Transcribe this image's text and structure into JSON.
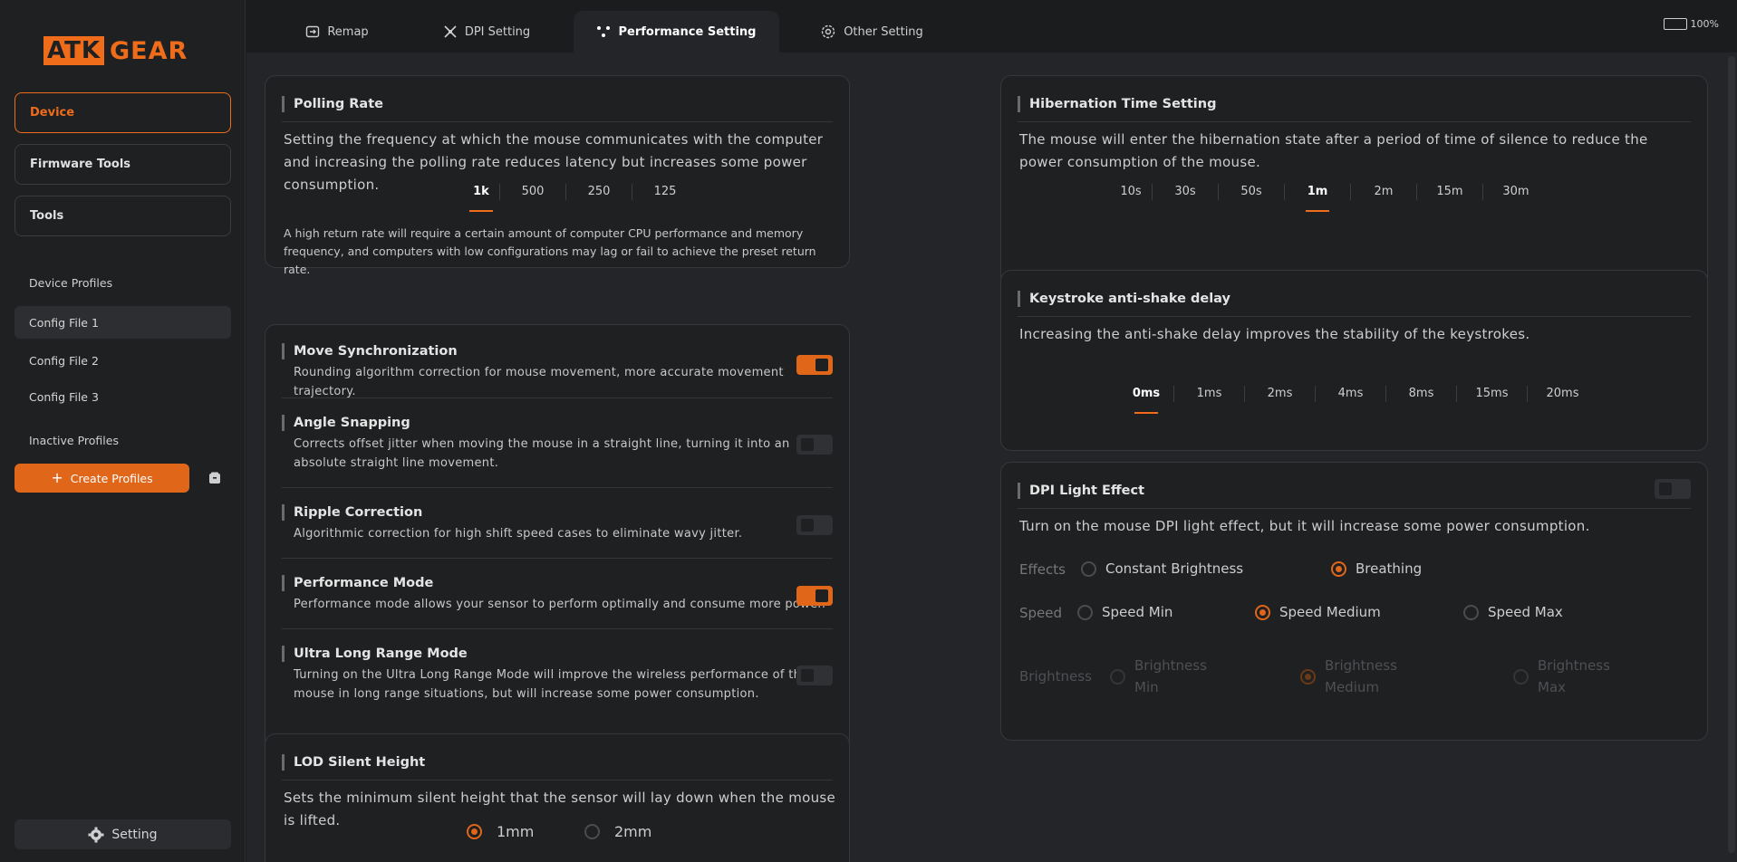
{
  "app": {
    "logo_box": "ATK",
    "logo_text": "GEAR",
    "battery": "100%"
  },
  "sidebar": {
    "nav": [
      {
        "label": "Device"
      },
      {
        "label": "Firmware Tools"
      },
      {
        "label": "Tools"
      }
    ],
    "device_profiles_label": "Device Profiles",
    "profiles": [
      "Config File 1",
      "Config File 2",
      "Config File 3"
    ],
    "inactive_label": "Inactive Profiles",
    "create_label": "Create Profiles",
    "setting_label": "Setting"
  },
  "tabs": [
    {
      "label": "Remap",
      "icon": "remap-icon"
    },
    {
      "label": "DPI Setting",
      "icon": "dpi-icon"
    },
    {
      "label": "Performance Setting",
      "icon": "performance-icon",
      "active": true
    },
    {
      "label": "Other Setting",
      "icon": "gear-icon"
    }
  ],
  "polling": {
    "title": "Polling Rate",
    "desc": "Setting the frequency at which the mouse communicates with the computer and increasing the polling rate reduces latency but increases some power consumption.",
    "options": [
      "1k",
      "500",
      "250",
      "125"
    ],
    "selected": "1k",
    "note": "A high return rate will require a certain amount of computer CPU performance and memory frequency, and computers with low configurations may lag or fail to achieve the preset return rate."
  },
  "features": [
    {
      "title": "Move Synchronization",
      "desc": "Rounding algorithm correction for mouse movement, more accurate movement trajectory.",
      "on": true
    },
    {
      "title": "Angle Snapping",
      "desc": "Corrects offset jitter when moving the mouse in a straight line, turning it into an absolute straight line movement.",
      "on": false
    },
    {
      "title": "Ripple Correction",
      "desc": "Algorithmic correction for high shift speed cases to eliminate wavy jitter.",
      "on": false
    },
    {
      "title": "Performance Mode",
      "desc": "Performance mode allows your sensor to perform optimally and consume more power.",
      "on": true
    },
    {
      "title": "Ultra Long Range Mode",
      "desc": "Turning on the Ultra Long Range Mode will improve the wireless performance of the mouse in long range situations, but will increase some power consumption.",
      "on": false
    }
  ],
  "lod": {
    "title": "LOD Silent Height",
    "desc": "Sets the minimum silent height that the sensor will lay down when the mouse is lifted.",
    "options": [
      "1mm",
      "2mm"
    ],
    "selected": "1mm"
  },
  "hibernation": {
    "title": "Hibernation Time Setting",
    "desc": "The mouse will enter the hibernation state after a period of time of silence to reduce the power consumption of the mouse.",
    "options": [
      "10s",
      "30s",
      "50s",
      "1m",
      "2m",
      "15m",
      "30m"
    ],
    "selected": "1m"
  },
  "antishake": {
    "title": "Keystroke anti-shake delay",
    "desc": "Increasing the anti-shake delay improves the stability of the keystrokes.",
    "options": [
      "0ms",
      "1ms",
      "2ms",
      "4ms",
      "8ms",
      "15ms",
      "20ms"
    ],
    "selected": "0ms"
  },
  "dpilight": {
    "title": "DPI Light Effect",
    "on": false,
    "desc": "Turn on the mouse DPI light effect, but it will increase some power consumption.",
    "effects_label": "Effects",
    "effects": [
      "Constant Brightness",
      "Breathing"
    ],
    "effects_selected": "Breathing",
    "speed_label": "Speed",
    "speeds": [
      "Speed Min",
      "Speed Medium",
      "Speed Max"
    ],
    "speed_selected": "Speed Medium",
    "brightness_label": "Brightness",
    "brightness": [
      "Brightness Min",
      "Brightness Medium",
      "Brightness Max"
    ],
    "brightness_selected": "Brightness Medium"
  },
  "colors": {
    "accent": "#ef6c1a",
    "background": "#1b1c1e",
    "card": "#1e2022"
  }
}
